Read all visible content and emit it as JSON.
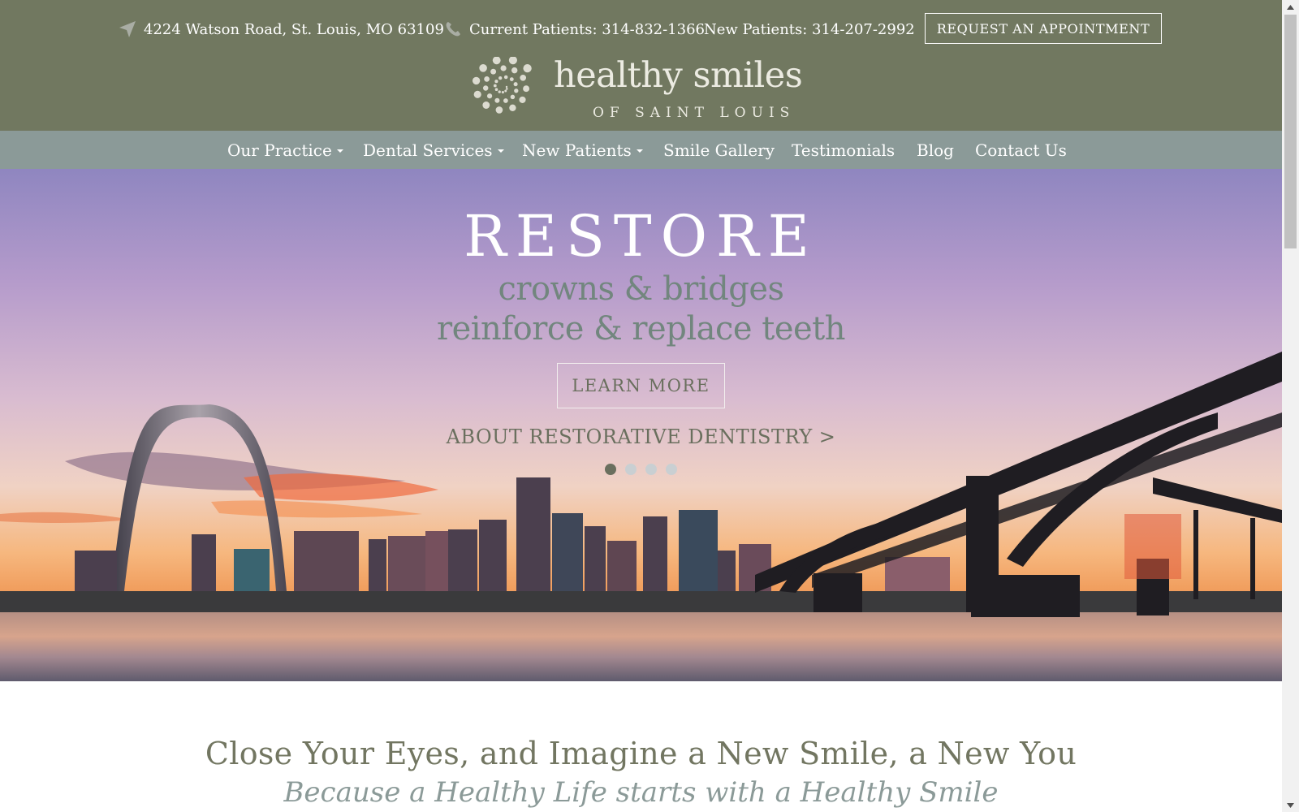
{
  "header": {
    "address": "4224 Watson Road, St. Louis, MO 63109",
    "current_patients": "Current Patients: 314-832-1366",
    "new_patients": "New Patients: 314-207-2992",
    "appointment_button": "REQUEST AN APPOINTMENT",
    "logo_name": "healthy smiles",
    "logo_sub": "OF SAINT LOUIS",
    "address_icon": "location-arrow-icon",
    "phone_icon": "phone-icon"
  },
  "nav": {
    "items": [
      {
        "label": "Our Practice",
        "dropdown": true
      },
      {
        "label": "Dental Services",
        "dropdown": true
      },
      {
        "label": "New Patients",
        "dropdown": true
      },
      {
        "label": "Smile Gallery",
        "dropdown": false
      },
      {
        "label": "Testimonials",
        "dropdown": false
      },
      {
        "label": "Blog",
        "dropdown": false
      },
      {
        "label": "Contact Us",
        "dropdown": false
      }
    ]
  },
  "hero": {
    "title": "RESTORE",
    "subtitle_line1": "crowns & bridges",
    "subtitle_line2": "reinforce & replace teeth",
    "cta": "LEARN MORE",
    "about_link": "ABOUT RESTORATIVE DENTISTRY >",
    "slides_total": 4,
    "active_slide": 1
  },
  "intro": {
    "title": "Close Your Eyes, and Imagine a New Smile, a New You",
    "subtitle": "Because a Healthy Life starts with a Healthy Smile"
  },
  "colors": {
    "header_bg": "#717860",
    "nav_bg": "#8b9a98",
    "accent_text": "#72867e",
    "dot_active": "#6a6f5e",
    "dot_inactive": "#c9cfd2"
  }
}
